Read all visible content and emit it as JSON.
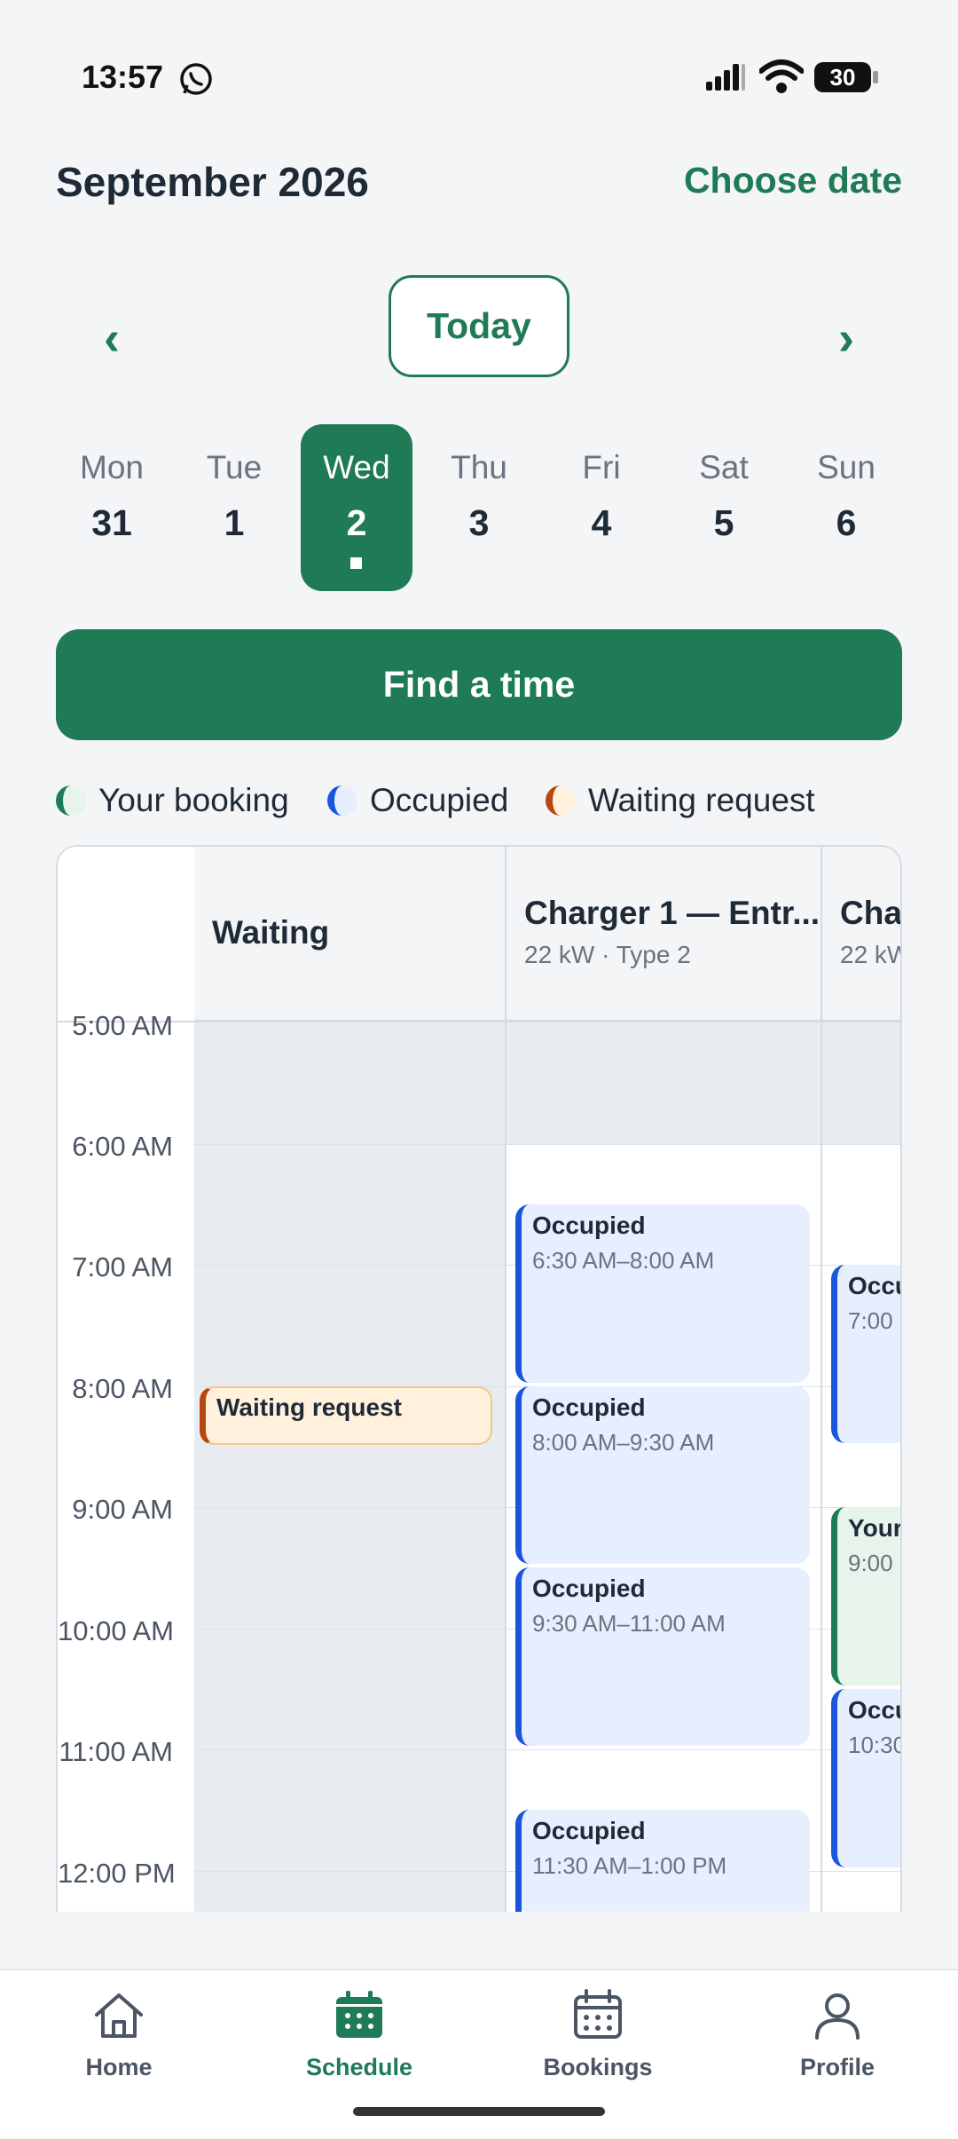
{
  "status": {
    "time": "13:57",
    "battery": "30"
  },
  "header": {
    "month": "September 2026",
    "choose_date": "Choose date"
  },
  "nav": {
    "prev": "‹",
    "next": "›",
    "today": "Today"
  },
  "days": [
    {
      "name": "Mon",
      "num": "31"
    },
    {
      "name": "Tue",
      "num": "1"
    },
    {
      "name": "Wed",
      "num": "2",
      "selected": true
    },
    {
      "name": "Thu",
      "num": "3"
    },
    {
      "name": "Fri",
      "num": "4"
    },
    {
      "name": "Sat",
      "num": "5"
    },
    {
      "name": "Sun",
      "num": "6"
    }
  ],
  "find_button": "Find a time",
  "legend": [
    {
      "label": "Your booking",
      "color": "#1f7a56"
    },
    {
      "label": "Occupied",
      "color": "#1a56db"
    },
    {
      "label": "Waiting request",
      "color": "#b4480f"
    }
  ],
  "columns": [
    {
      "title": "Waiting",
      "subtitle": ""
    },
    {
      "title": "Charger 1 — Entr...",
      "subtitle": "22 kW · Type 2"
    },
    {
      "title": "Char",
      "subtitle": "22 kW"
    }
  ],
  "times": [
    "5:00 AM",
    "6:00 AM",
    "7:00 AM",
    "8:00 AM",
    "9:00 AM",
    "10:00 AM",
    "11:00 AM",
    "12:00 PM"
  ],
  "events": {
    "waiting": [
      {
        "title": "Waiting request",
        "time": ""
      }
    ],
    "charger1": [
      {
        "title": "Occupied",
        "time": "6:30 AM–8:00 AM"
      },
      {
        "title": "Occupied",
        "time": "8:00 AM–9:30 AM"
      },
      {
        "title": "Occupied",
        "time": "9:30 AM–11:00 AM"
      },
      {
        "title": "Occupied",
        "time": "11:30 AM–1:00 PM"
      }
    ],
    "charger2": [
      {
        "title": "Occu",
        "time": "7:00"
      },
      {
        "title": "Your",
        "time": "9:00"
      },
      {
        "title": "Occu",
        "time": "10:30"
      }
    ]
  },
  "bottom_nav": [
    {
      "label": "Home",
      "icon": "home-icon"
    },
    {
      "label": "Schedule",
      "icon": "calendar-icon",
      "active": true
    },
    {
      "label": "Bookings",
      "icon": "calendar-grid-icon"
    },
    {
      "label": "Profile",
      "icon": "user-icon"
    }
  ],
  "colors": {
    "primary": "#1f7a56",
    "occupied": "#1a56db",
    "waiting": "#b4480f"
  }
}
